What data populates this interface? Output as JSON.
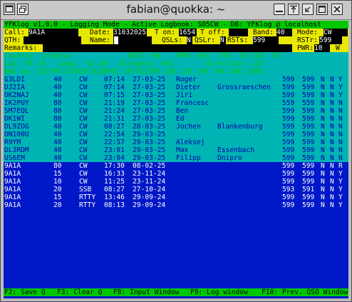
{
  "window": {
    "title": "fabian@quokka: ~"
  },
  "icons": {
    "menu": "terminal-menu-icon",
    "restore": "restore-icon",
    "up": "arrow-up-icon",
    "shade": "shade-icon",
    "maximize": "maximize-icon",
    "close": "close-icon"
  },
  "status_line": "YFKlog v1.0.0 - Logging Mode - Active Logbook: SO5CW - DB: YFKlog @ localhost",
  "form": {
    "call_label": "Call:",
    "call_value": "9A1A",
    "date_label": "Date:",
    "date_value": "31032025",
    "ton_label": "T on:",
    "ton_value": "1654",
    "toff_label": "T off:",
    "toff_value": "",
    "band_label": "Band:",
    "band_value": "40",
    "mode_label": "Mode:",
    "mode_value": "CW",
    "qth_label": "QTH:",
    "qth_value": "",
    "name_label": "Name:",
    "name_value": "",
    "qsls_label": "QSLs:",
    "qsls_value": "N",
    "qslr_label": "QSLr:",
    "qslr_value": "N",
    "rsts_label": "RSTs:",
    "rsts_value": "599",
    "rstr_label": "RSTr:",
    "rstr_value": "599",
    "remarks_label": "Remarks:",
    "remarks_value": "",
    "pwr_label": "PWR:",
    "pwr_value": "10",
    "pwr_unit": "W"
  },
  "info": {
    "country_line": "Country: Croatia              DXCC: 9A    WPX: 9A1  ITU: 28 CQZ: 15",
    "latlong_line": "Lat: 45.18   Long: -15.30   Distance: 443        Direction: 137",
    "wkd_line": "Wkd as: DJ1YFK DJ5CW DL80FOC SP/DJ1YFK 10C 15C 20C 40C 80C 160C"
  },
  "previous_qsos": [
    {
      "call": "G3LDI",
      "band": "40",
      "mode": "CW",
      "time": "07:14",
      "date": "27-03-25",
      "name": "Roger",
      "qth": "",
      "rsts": "599",
      "rstr": "599",
      "qsls": "N",
      "qslr": "N",
      "flag": "Y"
    },
    {
      "call": "DJ2IA",
      "band": "40",
      "mode": "CW",
      "time": "07:14",
      "date": "27-03-25",
      "name": "Dieter",
      "qth": "Grossraeschen",
      "rsts": "599",
      "rstr": "599",
      "qsls": "N",
      "qslr": "N",
      "flag": "Y"
    },
    {
      "call": "OK2NAJ",
      "band": "40",
      "mode": "CW",
      "time": "07:15",
      "date": "27-03-25",
      "name": "Jiri",
      "qth": "",
      "rsts": "599",
      "rstr": "599",
      "qsls": "N",
      "qslr": "N",
      "flag": "Y"
    },
    {
      "call": "IK2PUY",
      "band": "80",
      "mode": "CW",
      "time": "21:19",
      "date": "27-03-25",
      "name": "Francesc",
      "qth": "",
      "rsts": "559",
      "rstr": "559",
      "qsls": "N",
      "qslr": "N",
      "flag": "N"
    },
    {
      "call": "SM7EQL",
      "band": "80",
      "mode": "CW",
      "time": "21:24",
      "date": "27-03-25",
      "name": "Ben",
      "qth": "",
      "rsts": "599",
      "rstr": "599",
      "qsls": "N",
      "qslr": "N",
      "flag": "N"
    },
    {
      "call": "DK1WI",
      "band": "80",
      "mode": "CW",
      "time": "21:31",
      "date": "27-03-25",
      "name": "Ed",
      "qth": "",
      "rsts": "599",
      "rstr": "599",
      "qsls": "N",
      "qslr": "N",
      "flag": "N"
    },
    {
      "call": "DL9ZOG",
      "band": "40",
      "mode": "CW",
      "time": "08:27",
      "date": "28-03-25",
      "name": "Jochen",
      "qth": "Blankenburg",
      "rsts": "599",
      "rstr": "599",
      "qsls": "N",
      "qslr": "N",
      "flag": "N"
    },
    {
      "call": "ON100U",
      "band": "40",
      "mode": "CW",
      "time": "22:54",
      "date": "29-03-25",
      "name": "",
      "qth": "",
      "rsts": "599",
      "rstr": "599",
      "qsls": "N",
      "qslr": "N",
      "flag": "N"
    },
    {
      "call": "R9YM",
      "band": "40",
      "mode": "CW",
      "time": "22:57",
      "date": "29-03-25",
      "name": "Aleksej",
      "qth": "",
      "rsts": "599",
      "rstr": "599",
      "qsls": "N",
      "qslr": "N",
      "flag": "N"
    },
    {
      "call": "DL3RDM",
      "band": "40",
      "mode": "CW",
      "time": "23:01",
      "date": "29-03-25",
      "name": "Max",
      "qth": "Essenbach",
      "rsts": "599",
      "rstr": "599",
      "qsls": "N",
      "qslr": "N",
      "flag": "N"
    },
    {
      "call": "US6EM",
      "band": "40",
      "mode": "CW",
      "time": "23:04",
      "date": "29-03-25",
      "name": "Filipp",
      "qth": "Dnipro",
      "rsts": "599",
      "rstr": "599",
      "qsls": "N",
      "qslr": "N",
      "flag": "N"
    }
  ],
  "dupe_qsos": [
    {
      "call": "9A1A",
      "band": "80",
      "mode": "CW",
      "time": "17:30",
      "date": "08-02-25",
      "rsts": "599",
      "rstr": "599",
      "qsls": "N",
      "qslr": "N",
      "flag": "R"
    },
    {
      "call": "9A1A",
      "band": "15",
      "mode": "CW",
      "time": "16:33",
      "date": "23-11-24",
      "rsts": "599",
      "rstr": "599",
      "qsls": "N",
      "qslr": "N",
      "flag": "Y"
    },
    {
      "call": "9A1A",
      "band": "10",
      "mode": "CW",
      "time": "11:25",
      "date": "23-11-24",
      "rsts": "599",
      "rstr": "599",
      "qsls": "N",
      "qslr": "N",
      "flag": "Y"
    },
    {
      "call": "9A1A",
      "band": "20",
      "mode": "SSB",
      "time": "08:27",
      "date": "27-10-24",
      "rsts": "593",
      "rstr": "591",
      "qsls": "N",
      "qslr": "N",
      "flag": "Y"
    },
    {
      "call": "9A1A",
      "band": "15",
      "mode": "RTTY",
      "time": "13:46",
      "date": "29-09-24",
      "rsts": "599",
      "rstr": "599",
      "qsls": "N",
      "qslr": "N",
      "flag": "Y"
    },
    {
      "call": "9A1A",
      "band": "20",
      "mode": "RTTY",
      "time": "08:13",
      "date": "29-09-24",
      "rsts": "599",
      "rstr": "599",
      "qsls": "N",
      "qslr": "N",
      "flag": "Y"
    }
  ],
  "footer": {
    "f2": "F2: Save Q",
    "f3": "F3: Clear Q",
    "f8": "F8: Input Window",
    "f9": "F9: Log window",
    "f10": "F10: Prev. QSO Window"
  }
}
